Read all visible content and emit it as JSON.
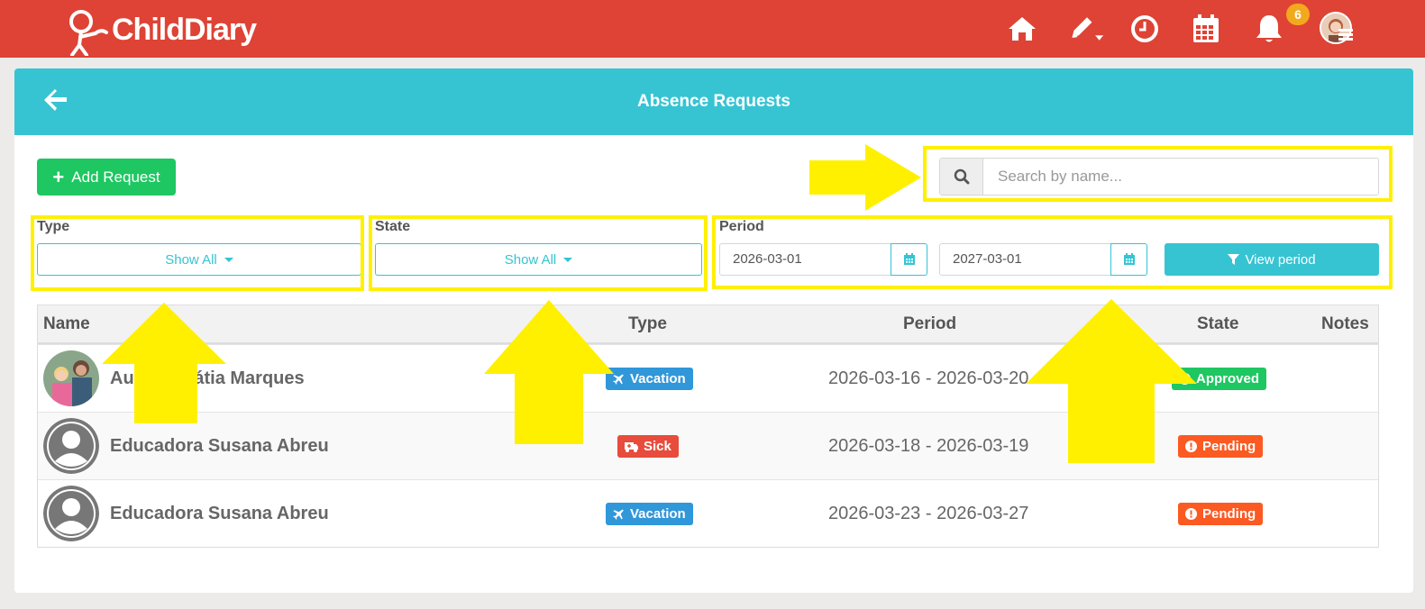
{
  "navbar": {
    "brand": "ChildDiary",
    "notification_count": "6",
    "icons": [
      "home-icon",
      "pencil-icon",
      "clock-icon",
      "calendar-icon",
      "bell-icon",
      "avatar"
    ]
  },
  "page": {
    "title": "Absence Requests",
    "add_button_label": "Add Request",
    "search_placeholder": "Search by name..."
  },
  "filters": {
    "type_label": "Type",
    "type_value": "Show All",
    "state_label": "State",
    "state_value": "Show All",
    "period_label": "Period",
    "period_start": "2026-03-01",
    "period_end": "2027-03-01",
    "view_period_label": "View period"
  },
  "table": {
    "headers": {
      "name": "Name",
      "type": "Type",
      "period": "Period",
      "state": "State",
      "notes": "Notes"
    },
    "rows": [
      {
        "name": "Auxiliar Cátia Marques",
        "type": "Vacation",
        "period": "2026-03-16 - 2026-03-20",
        "state": "Approved",
        "notes": ""
      },
      {
        "name": "Educadora Susana Abreu",
        "type": "Sick",
        "period": "2026-03-18 - 2026-03-19",
        "state": "Pending",
        "notes": ""
      },
      {
        "name": "Educadora Susana Abreu",
        "type": "Vacation",
        "period": "2026-03-23 - 2026-03-27",
        "state": "Pending",
        "notes": ""
      }
    ]
  },
  "colors": {
    "navbar": "#de4335",
    "header": "#36c4d3",
    "add_button": "#1ec761",
    "vacation": "#3097d9",
    "sick": "#e74c3c",
    "approved": "#1ec761",
    "pending": "#fb5a22",
    "annotation": "#fff000"
  }
}
